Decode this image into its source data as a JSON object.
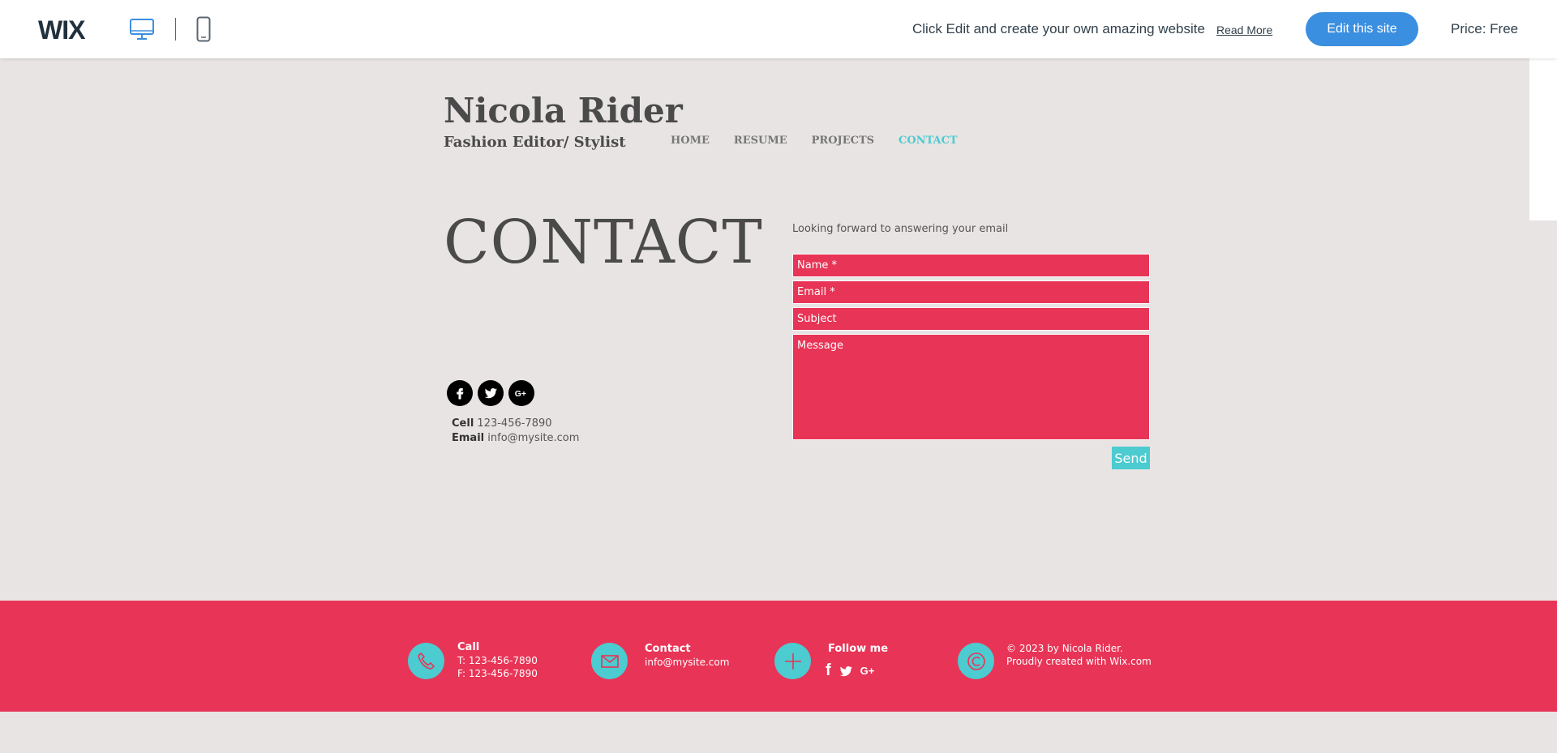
{
  "wix_bar": {
    "logo": "WIX",
    "promo": "Click Edit and create your own amazing website",
    "read_more": "Read More",
    "edit_button": "Edit this site",
    "price": "Price: Free"
  },
  "site": {
    "name": "Nicola Rider",
    "subtitle": "Fashion Editor/ Stylist",
    "nav": [
      "HOME",
      "RESUME",
      "PROJECTS",
      "CONTACT"
    ],
    "active_nav": "CONTACT"
  },
  "contact": {
    "title": "CONTACT",
    "cell_label": "Cell",
    "cell_value": "123-456-7890",
    "email_label": "Email",
    "email_value": "info@mysite.com",
    "socials": [
      "facebook",
      "twitter",
      "google-plus"
    ]
  },
  "form": {
    "intro": "Looking forward to answering your email",
    "name_placeholder": "Name *",
    "email_placeholder": "Email *",
    "subject_placeholder": "Subject",
    "message_placeholder": "Message",
    "send": "Send"
  },
  "footer": {
    "call_title": "Call",
    "call_t": "T: 123-456-7890",
    "call_f": "F: 123-456-7890",
    "contact_title": "Contact",
    "contact_email": "info@mysite.com",
    "follow_title": "Follow me",
    "copyright": "© 2023 by Nicola Rider.",
    "created": "Proudly created with Wix.com"
  },
  "colors": {
    "accent_red": "#e83456",
    "accent_teal": "#4ccbd0",
    "wix_blue": "#3b8fe0"
  }
}
